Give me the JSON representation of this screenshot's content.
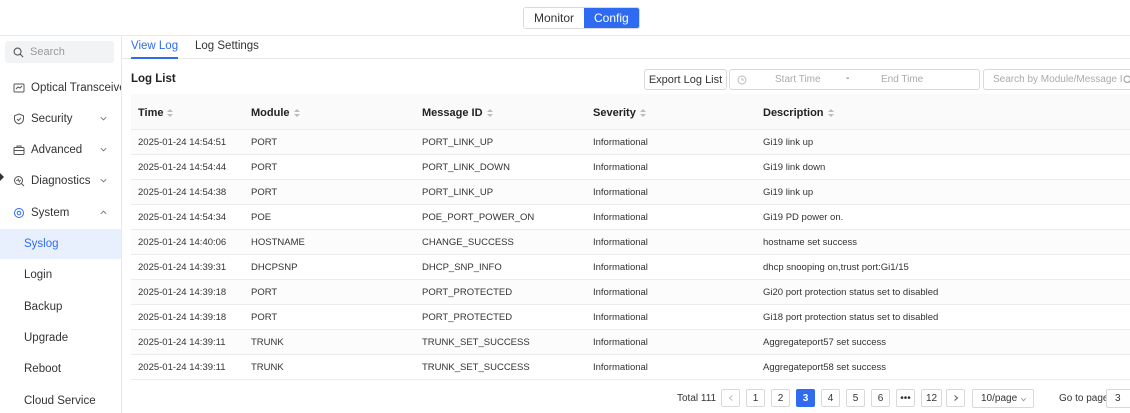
{
  "header": {
    "modes": [
      {
        "label": "Monitor",
        "active": false
      },
      {
        "label": "Config",
        "active": true
      }
    ]
  },
  "sidebar": {
    "search_placeholder": "Search",
    "items": [
      {
        "label": "Optical Transceiver Management",
        "icon": "transceiver-icon",
        "type": "group"
      },
      {
        "label": "Security",
        "icon": "shield-icon",
        "type": "group"
      },
      {
        "label": "Advanced",
        "icon": "briefcase-icon",
        "type": "group"
      },
      {
        "label": "Diagnostics",
        "icon": "diagnostics-icon",
        "type": "group"
      },
      {
        "label": "System",
        "icon": "gear-icon",
        "type": "group",
        "expanded": true
      },
      {
        "label": "Syslog",
        "type": "sub",
        "active": true
      },
      {
        "label": "Login",
        "type": "sub"
      },
      {
        "label": "Backup",
        "type": "sub"
      },
      {
        "label": "Upgrade",
        "type": "sub"
      },
      {
        "label": "Reboot",
        "type": "sub"
      },
      {
        "label": "Cloud Service",
        "type": "sub"
      }
    ]
  },
  "tabs": [
    {
      "label": "View Log",
      "active": true
    },
    {
      "label": "Log Settings",
      "active": false
    }
  ],
  "log_list": {
    "title": "Log List",
    "export_label": "Export Log List",
    "start_placeholder": "Start Time",
    "end_placeholder": "End Time",
    "range_separator": "-",
    "search_placeholder": "Search by Module/Message ID/Severity",
    "columns": [
      "Time",
      "Module",
      "Message ID",
      "Severity",
      "Description"
    ],
    "rows": [
      [
        "2025-01-24 14:54:51",
        "PORT",
        "PORT_LINK_UP",
        "Informational",
        "Gi19 link up"
      ],
      [
        "2025-01-24 14:54:44",
        "PORT",
        "PORT_LINK_DOWN",
        "Informational",
        "Gi19 link down"
      ],
      [
        "2025-01-24 14:54:38",
        "PORT",
        "PORT_LINK_UP",
        "Informational",
        "Gi19 link up"
      ],
      [
        "2025-01-24 14:54:34",
        "POE",
        "POE_PORT_POWER_ON",
        "Informational",
        "Gi19 PD power on."
      ],
      [
        "2025-01-24 14:40:06",
        "HOSTNAME",
        "CHANGE_SUCCESS",
        "Informational",
        "hostname set success"
      ],
      [
        "2025-01-24 14:39:31",
        "DHCPSNP",
        "DHCP_SNP_INFO",
        "Informational",
        "dhcp snooping on,trust port:Gi1/15"
      ],
      [
        "2025-01-24 14:39:18",
        "PORT",
        "PORT_PROTECTED",
        "Informational",
        "Gi20 port protection status set to disabled"
      ],
      [
        "2025-01-24 14:39:18",
        "PORT",
        "PORT_PROTECTED",
        "Informational",
        "Gi18 port protection status set to disabled"
      ],
      [
        "2025-01-24 14:39:11",
        "TRUNK",
        "TRUNK_SET_SUCCESS",
        "Informational",
        "Aggregateport57 set success"
      ],
      [
        "2025-01-24 14:39:11",
        "TRUNK",
        "TRUNK_SET_SUCCESS",
        "Informational",
        "Aggregateport58 set success"
      ]
    ]
  },
  "pagination": {
    "total_label": "Total 111",
    "pages": [
      "1",
      "2",
      "3",
      "4",
      "5",
      "6",
      "•••",
      "12"
    ],
    "current_page": "3",
    "page_size": "10/page",
    "goto_label": "Go to page",
    "goto_value": "3"
  },
  "colors": {
    "accent": "#2f6bf0",
    "active_bg": "#e8f0fe"
  }
}
